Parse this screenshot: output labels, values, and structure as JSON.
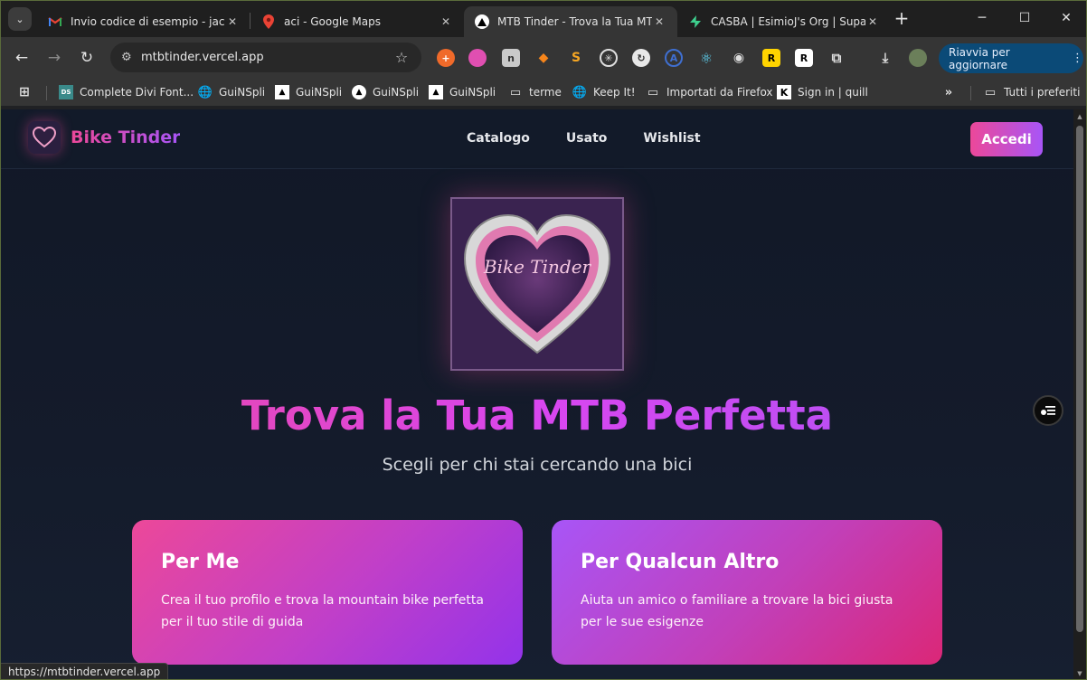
{
  "browser": {
    "tabs": [
      {
        "title": "Invio codice di esempio - jacop",
        "favicon": "gmail-icon",
        "active": false
      },
      {
        "title": "aci - Google Maps",
        "favicon": "maps-pin-icon",
        "active": false
      },
      {
        "title": "MTB Tinder - Trova la Tua MTB",
        "favicon": "vercel-triangle-icon",
        "active": true
      },
      {
        "title": "CASBA | EsimioJ's Org | Supaba",
        "favicon": "supabase-bolt-icon",
        "active": false
      }
    ],
    "url": "mtbtinder.vercel.app",
    "update_button": "Riavvia per aggiornare",
    "bookmarks": [
      {
        "label": "Complete Divi Font..."
      },
      {
        "label": "GuiNSpli"
      },
      {
        "label": "GuiNSpli"
      },
      {
        "label": "GuiNSpli"
      },
      {
        "label": "GuiNSpli"
      },
      {
        "label": "terme"
      },
      {
        "label": "Keep It!"
      },
      {
        "label": "Importati da Firefox"
      },
      {
        "label": "Sign in | quill"
      }
    ],
    "all_bookmarks": "Tutti i preferiti",
    "status_url": "https://mtbtinder.vercel.app"
  },
  "site": {
    "brand": "Bike Tinder",
    "nav": [
      "Catalogo",
      "Usato",
      "Wishlist"
    ],
    "login": "Accedi",
    "hero_logo_text": "Bike Tinder",
    "title": "Trova la Tua MTB Perfetta",
    "subtitle": "Scegli per chi stai cercando una bici",
    "cards": [
      {
        "title": "Per Me",
        "text": "Crea il tuo profilo e trova la mountain bike perfetta per il tuo stile di guida"
      },
      {
        "title": "Per Qualcun Altro",
        "text": "Aiuta un amico o familiare a trovare la bici giusta per le sue esigenze"
      }
    ]
  },
  "colors": {
    "accent_pink": "#ec4899",
    "accent_purple": "#a855f7",
    "page_bg": "#111827"
  }
}
